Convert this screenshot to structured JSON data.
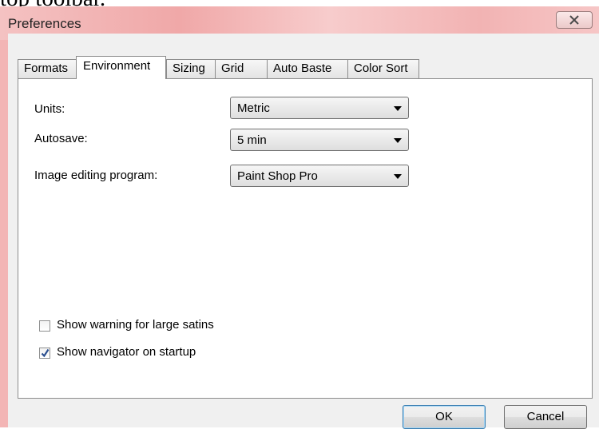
{
  "fragment_text": "top toolbar.",
  "window": {
    "title": "Preferences",
    "close_glyph": "X"
  },
  "tabs": [
    {
      "label": "Formats",
      "active": false
    },
    {
      "label": "Environment",
      "active": true
    },
    {
      "label": "Sizing",
      "active": false
    },
    {
      "label": "Grid",
      "active": false
    },
    {
      "label": "Auto Baste",
      "active": false
    },
    {
      "label": "Color Sort",
      "active": false
    }
  ],
  "fields": {
    "units": {
      "label": "Units:",
      "value": "Metric"
    },
    "autosave": {
      "label": "Autosave:",
      "value": "5 min"
    },
    "image_program": {
      "label": "Image editing program:",
      "value": "Paint Shop Pro"
    }
  },
  "checkboxes": {
    "large_satins": {
      "label": "Show warning for large satins",
      "checked": false
    },
    "navigator": {
      "label": "Show navigator on startup",
      "checked": true
    }
  },
  "buttons": {
    "ok": "OK",
    "cancel": "Cancel"
  },
  "icons": {
    "close": "close-icon",
    "dropdown": "chevron-down-icon",
    "check": "checkmark-icon"
  }
}
